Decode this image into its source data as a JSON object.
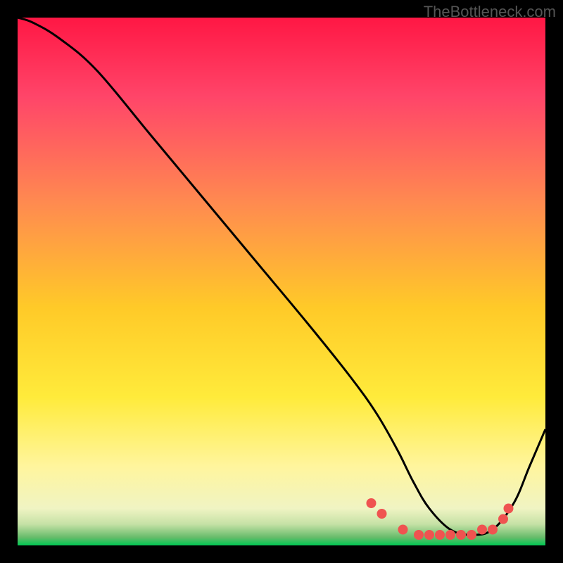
{
  "watermark": "TheBottleneck.com",
  "chart_data": {
    "type": "line",
    "title": "",
    "xlabel": "",
    "ylabel": "",
    "xlim": [
      0,
      100
    ],
    "ylim": [
      0,
      100
    ],
    "grid": false,
    "background_gradient": {
      "type": "vertical",
      "stops": [
        {
          "pos": 0.0,
          "color": "#ff1744"
        },
        {
          "pos": 0.15,
          "color": "#ff4569"
        },
        {
          "pos": 0.35,
          "color": "#ff8a50"
        },
        {
          "pos": 0.55,
          "color": "#ffca28"
        },
        {
          "pos": 0.72,
          "color": "#ffeb3b"
        },
        {
          "pos": 0.85,
          "color": "#fff59d"
        },
        {
          "pos": 0.93,
          "color": "#f0f4c3"
        },
        {
          "pos": 0.96,
          "color": "#c5e1a5"
        },
        {
          "pos": 0.985,
          "color": "#66bb6a"
        },
        {
          "pos": 1.0,
          "color": "#00c853"
        }
      ]
    },
    "series": [
      {
        "name": "bottleneck-curve",
        "color": "#000000",
        "x": [
          0,
          3,
          8,
          15,
          25,
          35,
          45,
          55,
          63,
          68,
          72,
          75,
          78,
          82,
          86,
          90,
          94,
          97,
          100
        ],
        "values": [
          100,
          99,
          96,
          90,
          78,
          66,
          54,
          42,
          32,
          25,
          18,
          12,
          7,
          3,
          2,
          3,
          8,
          15,
          22
        ]
      }
    ],
    "markers": {
      "name": "bottleneck-zone-dots",
      "color": "#ef5350",
      "radius": 7,
      "x": [
        67,
        69,
        73,
        76,
        78,
        80,
        82,
        84,
        86,
        88,
        90,
        92,
        93
      ],
      "values": [
        8,
        6,
        3,
        2,
        2,
        2,
        2,
        2,
        2,
        3,
        3,
        5,
        7
      ]
    }
  }
}
